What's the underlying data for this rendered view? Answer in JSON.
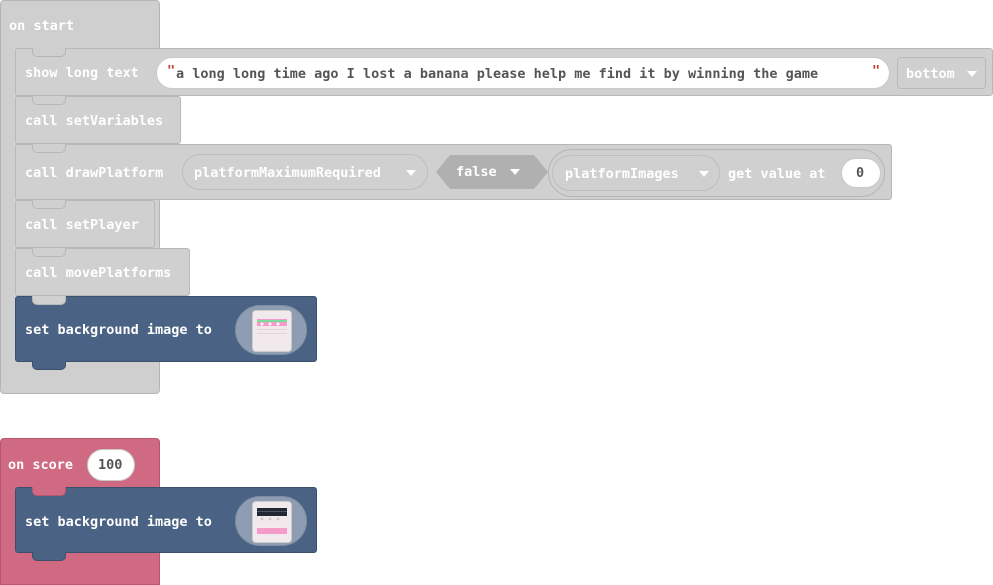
{
  "on_start": {
    "hat_label": "on start",
    "show_long_text": {
      "label": "show long text",
      "text_value": "a long long time ago I lost a banana please help me find it by winning the game",
      "position_value": "bottom"
    },
    "set_variables": "call setVariables",
    "draw_platform": {
      "label": "call drawPlatform",
      "arg1": "platformMaximumRequired",
      "arg2": "false",
      "array_var": "platformImages",
      "get_value_label": "get value at",
      "index": "0"
    },
    "set_player": "call setPlayer",
    "move_platforms": "call movePlatforms",
    "set_background": "set background image to"
  },
  "on_score": {
    "hat_label": "on score",
    "score_value": "100",
    "set_background": "set background image to"
  },
  "colors": {
    "functions_gray": "#d0d0d0",
    "scene_navy": "#4a6283",
    "info_pink": "#d06982",
    "quote_red": "#c0392b"
  }
}
